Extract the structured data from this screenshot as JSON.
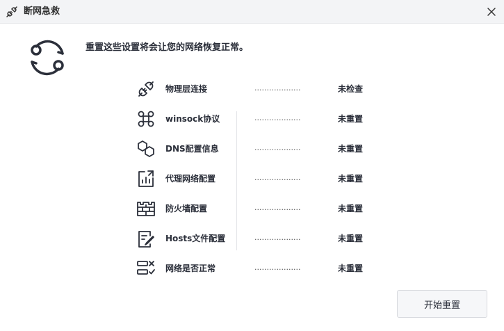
{
  "window": {
    "title": "断网急救",
    "title_icon": "plug-icon",
    "close_icon": "close-icon"
  },
  "header": {
    "icon": "network-reset-icon",
    "message": "重置这些设置将会让您的网络恢复正常。"
  },
  "items": [
    {
      "icon": "plug-icon",
      "label": "物理层连接",
      "dots": "...................",
      "status": "未检查"
    },
    {
      "icon": "network-nodes-icon",
      "label": "winsock协议",
      "dots": "...................",
      "status": "未重置"
    },
    {
      "icon": "dns-icon",
      "label": "DNS配置信息",
      "dots": "...................",
      "status": "未重置"
    },
    {
      "icon": "proxy-chart-icon",
      "label": "代理网络配置",
      "dots": "...................",
      "status": "未重置"
    },
    {
      "icon": "firewall-icon",
      "label": "防火墙配置",
      "dots": "...................",
      "status": "未重置"
    },
    {
      "icon": "hosts-file-icon",
      "label": "Hosts文件配置",
      "dots": "...................",
      "status": "未重置"
    },
    {
      "icon": "checklist-icon",
      "label": "网络是否正常",
      "dots": "...................",
      "status": "未重置"
    }
  ],
  "actions": {
    "start_label": "开始重置"
  },
  "colors": {
    "text": "#2b2f3a",
    "titlebar": "#f3f4f6",
    "button_bg": "#f6f7f9"
  }
}
